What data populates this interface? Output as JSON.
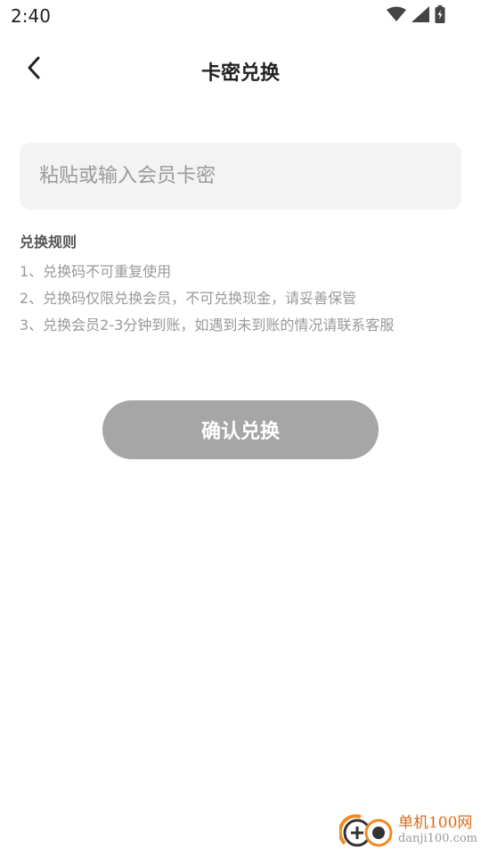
{
  "status_bar": {
    "time": "2:40",
    "icons": [
      "wifi-icon",
      "cellular-signal-icon",
      "battery-charging-icon"
    ]
  },
  "nav": {
    "title": "卡密兑换",
    "back_icon": "chevron-left-icon"
  },
  "code_input": {
    "placeholder": "粘贴或输入会员卡密",
    "value": ""
  },
  "rules": {
    "title": "兑换规则",
    "items": [
      "1、兑换码不可重复使用",
      "2、兑换码仅限兑换会员，不可兑换现金，请妥善保管",
      "3、兑换会员2-3分钟到账，如遇到未到账的情况请联系客服"
    ]
  },
  "confirm_button": {
    "label": "确认兑换"
  },
  "watermark": {
    "brand": "单机100网",
    "url": "danji100.com"
  },
  "colors": {
    "button_disabled": "#a6a6a6",
    "input_bg": "#f3f3f3",
    "watermark_orange": "#e06a1a"
  }
}
